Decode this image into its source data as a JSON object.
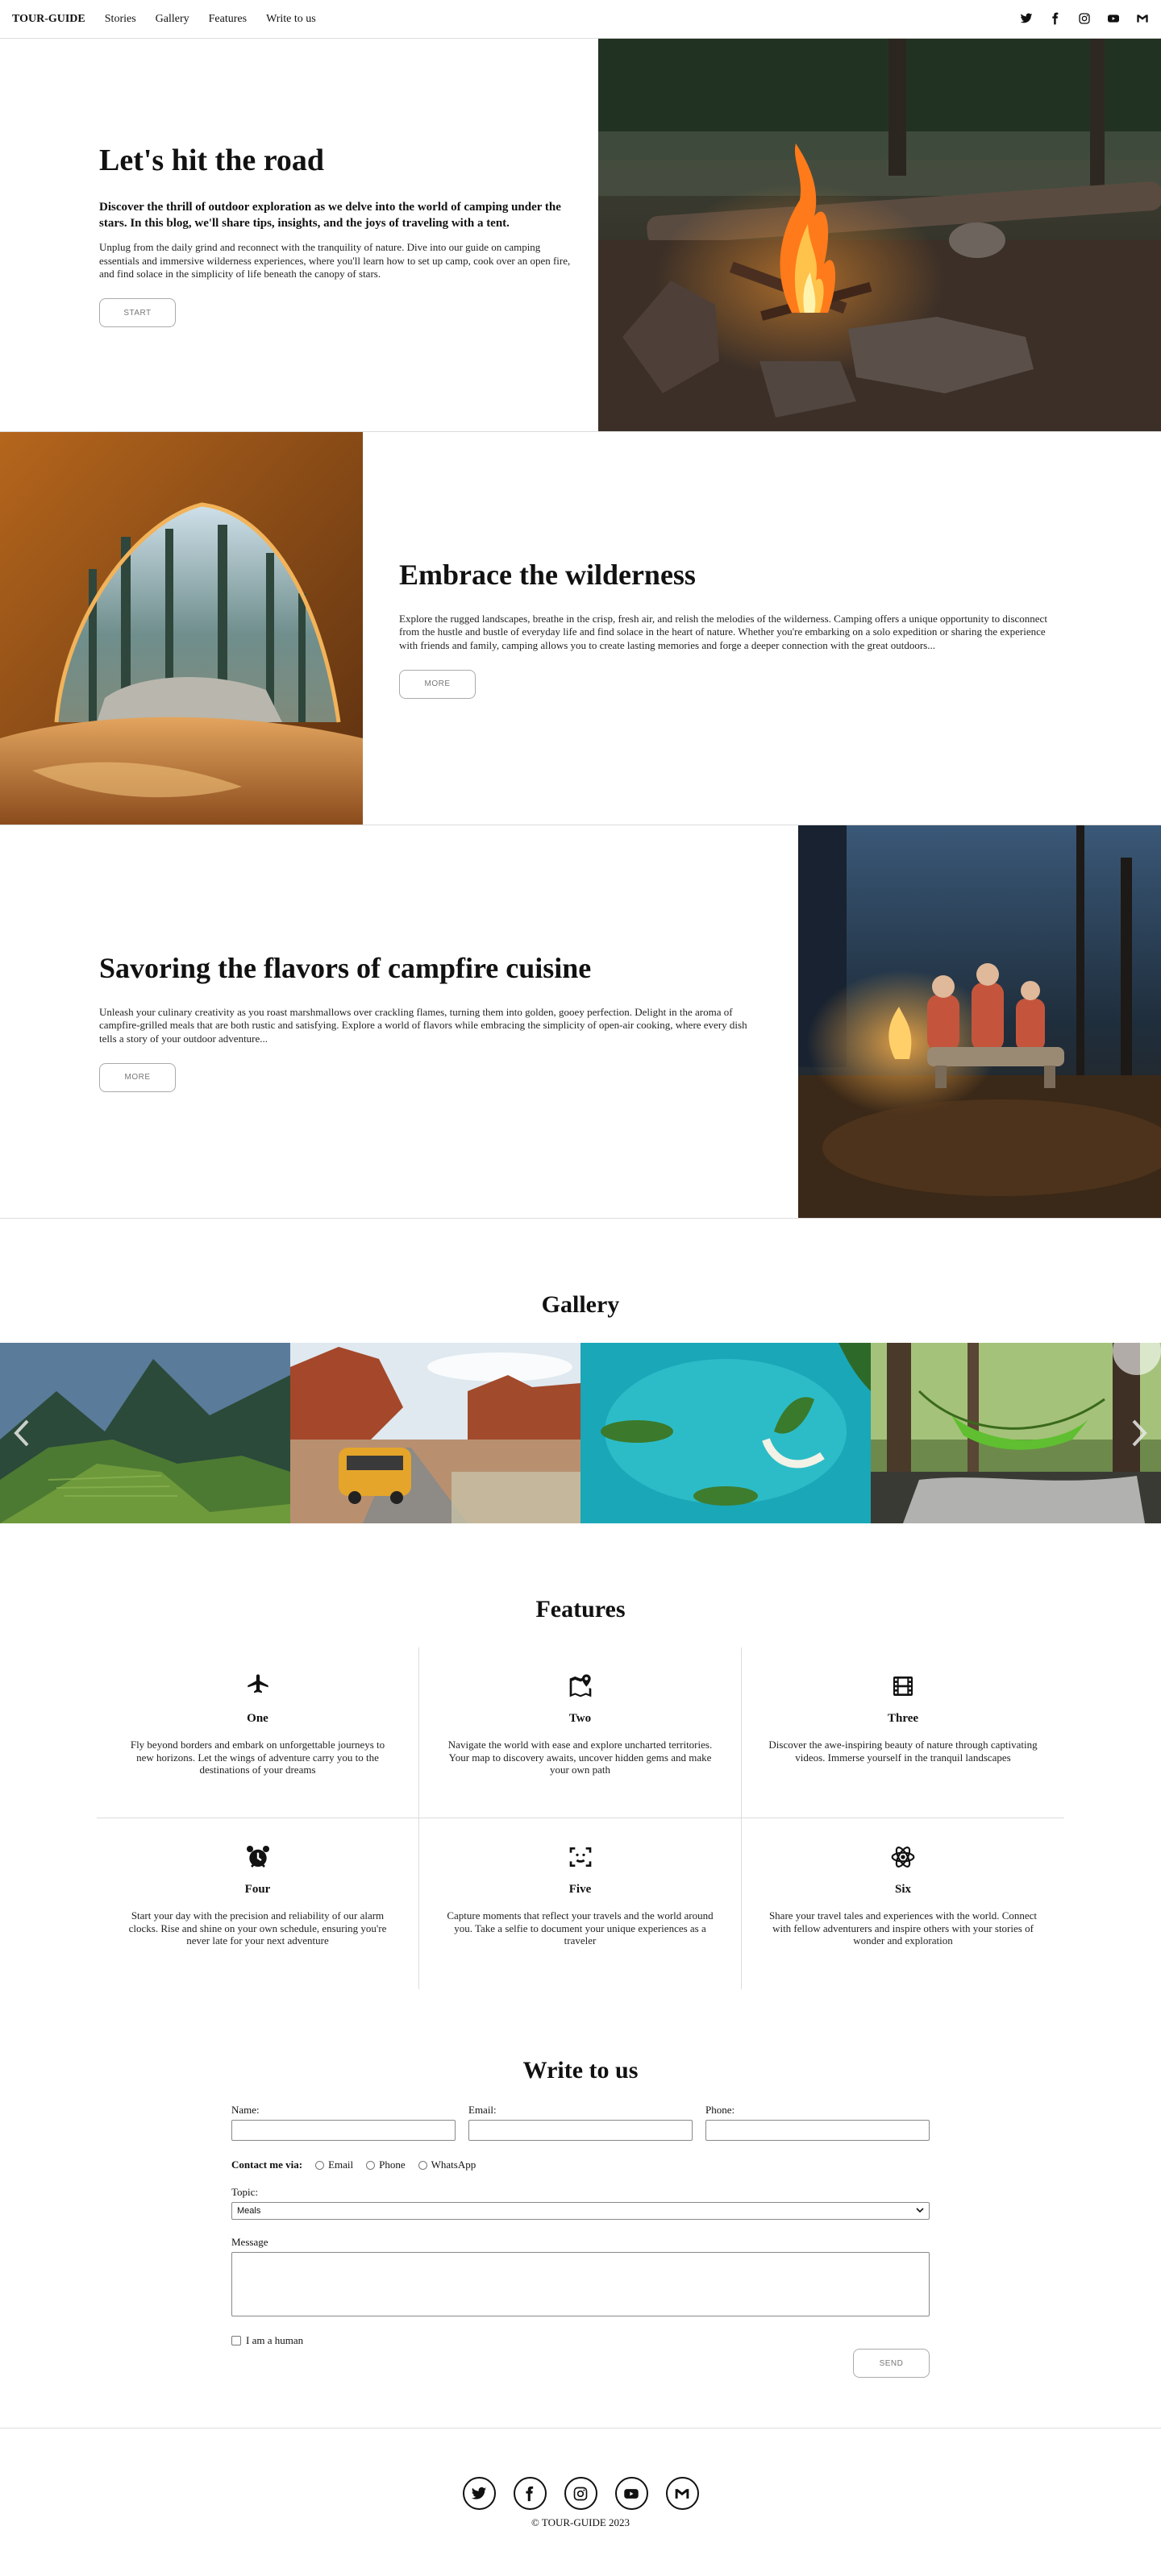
{
  "nav": {
    "brand": "TOUR-GUIDE",
    "links": [
      "Stories",
      "Gallery",
      "Features",
      "Write to us"
    ],
    "social_icons": [
      "twitter-icon",
      "facebook-icon",
      "instagram-icon",
      "youtube-icon",
      "gmail-icon"
    ]
  },
  "hero": {
    "title": "Let's hit the road",
    "lead": "Discover the thrill of outdoor exploration as we delve into the world of camping under the stars. In this blog, we'll share tips, insights, and the joys of traveling with a tent.",
    "text": "Unplug from the daily grind and reconnect with the tranquility of nature. Dive into our guide on camping essentials and immersive wilderness experiences, where you'll learn how to set up camp, cook over an open fire, and find solace in the simplicity of life beneath the canopy of stars.",
    "button": "START",
    "image": "campfire-photo"
  },
  "wilderness": {
    "title": "Embrace the wilderness",
    "text": "Explore the rugged landscapes, breathe in the crisp, fresh air, and relish the melodies of the wilderness. Camping offers a unique opportunity to disconnect from the hustle and bustle of everyday life and find solace in the heart of nature. Whether you're embarking on a solo expedition or sharing the experience with friends and family, camping allows you to create lasting memories and forge a deeper connection with the great outdoors...",
    "button": "MORE",
    "image": "tent-view-photo"
  },
  "cuisine": {
    "title": "Savoring the flavors of campfire cuisine",
    "text": "Unleash your culinary creativity as you roast marshmallows over crackling flames, turning them into golden, gooey perfection. Delight in the aroma of campfire-grilled meals that are both rustic and satisfying. Explore a world of flavors while embracing the simplicity of open-air cooking, where every dish tells a story of your outdoor adventure...",
    "button": "MORE",
    "image": "campfire-group-photo"
  },
  "gallery": {
    "title": "Gallery",
    "slides": [
      "machu-picchu-photo",
      "desert-van-photo",
      "turquoise-lagoon-photo",
      "forest-hammock-photo"
    ],
    "prev_icon": "chevron-left-icon",
    "next_icon": "chevron-right-icon"
  },
  "features": {
    "title": "Features",
    "items": [
      {
        "icon": "airplane-icon",
        "title": "One",
        "text": "Fly beyond borders and embark on unforgettable journeys to new horizons. Let the wings of adventure carry you to the destinations of your dreams"
      },
      {
        "icon": "map-pin-icon",
        "title": "Two",
        "text": "Navigate the world with ease and explore uncharted territories. Your map to discovery awaits, uncover hidden gems and make your own path"
      },
      {
        "icon": "film-icon",
        "title": "Three",
        "text": "Discover the awe-inspiring beauty of nature through captivating videos. Immerse yourself in the tranquil landscapes"
      },
      {
        "icon": "alarm-clock-icon",
        "title": "Four",
        "text": "Start your day with the precision and reliability of our alarm clocks. Rise and shine on your own schedule, ensuring you're never late for your next adventure"
      },
      {
        "icon": "face-scan-icon",
        "title": "Five",
        "text": "Capture moments that reflect your travels and the world around you. Take a selfie to document your unique experiences as a traveler"
      },
      {
        "icon": "atom-icon",
        "title": "Six",
        "text": "Share your travel tales and experiences with the world. Connect with fellow adventurers and inspire others with your stories of wonder and exploration"
      }
    ]
  },
  "contact": {
    "title": "Write to us",
    "name_label": "Name:",
    "email_label": "Email:",
    "phone_label": "Phone:",
    "contact_via_label": "Contact me via:",
    "contact_options": [
      "Email",
      "Phone",
      "WhatsApp"
    ],
    "topic_label": "Topic:",
    "topic_value": "Meals",
    "message_label": "Message",
    "human_label": "I am a human",
    "send_button": "SEND"
  },
  "footer": {
    "social_icons": [
      "twitter-icon",
      "facebook-icon",
      "instagram-icon",
      "youtube-icon",
      "gmail-icon"
    ],
    "copyright": "© TOUR-GUIDE 2023"
  }
}
